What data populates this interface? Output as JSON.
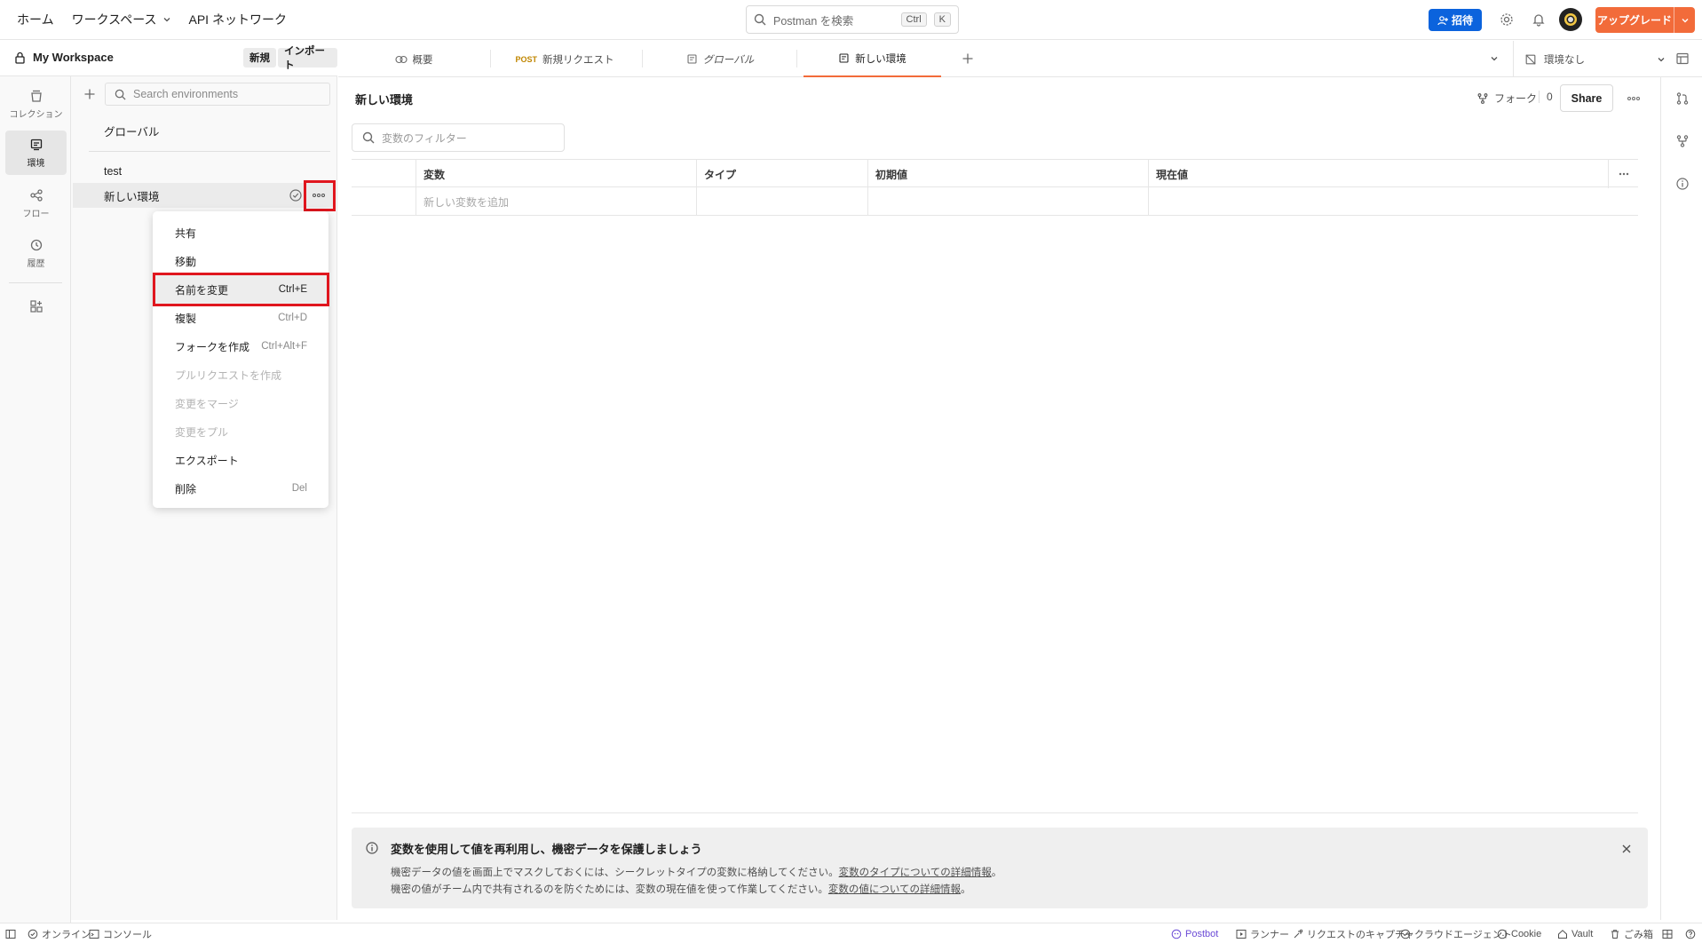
{
  "topbar": {
    "nav": [
      "ホーム",
      "ワークスペース",
      "API ネットワーク"
    ],
    "search_placeholder": "Postman を検索",
    "search_kbd": [
      "Ctrl",
      "K"
    ],
    "invite_label": "招待",
    "upgrade_label": "アップグレード"
  },
  "workspace": {
    "name": "My Workspace",
    "new_label": "新規",
    "import_label": "インポート"
  },
  "rail": [
    {
      "label": "コレクション",
      "icon": "collection-icon"
    },
    {
      "label": "環境",
      "icon": "environment-icon",
      "active": true
    },
    {
      "label": "フロー",
      "icon": "flow-icon"
    },
    {
      "label": "履歴",
      "icon": "history-icon"
    }
  ],
  "envlist": {
    "search_placeholder": "Search environments",
    "global": "グローバル",
    "items": [
      "test",
      "新しい環境"
    ]
  },
  "menu": {
    "items": [
      {
        "label": "共有",
        "shortcut": ""
      },
      {
        "label": "移動",
        "shortcut": ""
      },
      {
        "label": "名前を変更",
        "shortcut": "Ctrl+E"
      },
      {
        "label": "複製",
        "shortcut": "Ctrl+D"
      },
      {
        "label": "フォークを作成",
        "shortcut": "Ctrl+Alt+F"
      },
      {
        "label": "プルリクエストを作成",
        "shortcut": ""
      },
      {
        "label": "変更をマージ",
        "shortcut": ""
      },
      {
        "label": "変更をプル",
        "shortcut": ""
      },
      {
        "label": "エクスポート",
        "shortcut": ""
      },
      {
        "label": "削除",
        "shortcut": "Del"
      }
    ]
  },
  "tabs": {
    "items": [
      {
        "label": "概要"
      },
      {
        "method": "POST",
        "label": "新規リクエスト"
      },
      {
        "label": "グローバル"
      },
      {
        "label": "新しい環境"
      }
    ],
    "env_select": "環境なし"
  },
  "main": {
    "title": "新しい環境",
    "fork_label": "フォーク",
    "fork_count": "0",
    "share_label": "Share",
    "filter_placeholder": "変数のフィルター",
    "columns": [
      "変数",
      "タイプ",
      "初期値",
      "現在値"
    ],
    "add_placeholder": "新しい変数を追加"
  },
  "info": {
    "title": "変数を使用して値を再利用し、機密データを保護しましょう",
    "line1": "機密データの値を画面上でマスクしておくには、シークレットタイプの変数に格納してください。",
    "link1": "変数のタイプについての詳細情報",
    "line2": "機密の値がチーム内で共有されるのを防ぐためには、変数の現在値を使って作業してください。",
    "link2": "変数の値についての詳細情報",
    "period": "。"
  },
  "status": {
    "online": "オンライン",
    "console": "コンソール",
    "postbot": "Postbot",
    "runner": "ランナー",
    "capture": "リクエストのキャプチャ",
    "cloud_agent": "クラウドエージェント",
    "cookie": "Cookie",
    "vault": "Vault",
    "trash": "ごみ箱"
  }
}
